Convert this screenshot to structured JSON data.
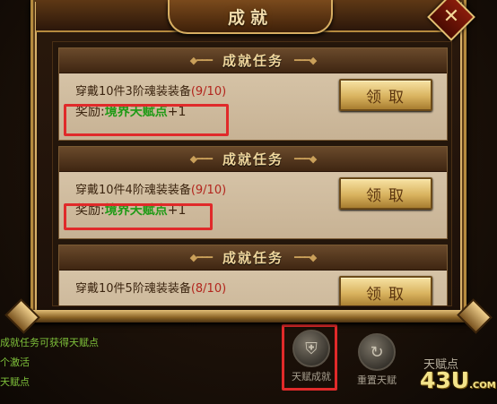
{
  "dialog": {
    "title": "成就",
    "close_icon": "✕"
  },
  "cards": [
    {
      "header": "成就任务",
      "task": "穿戴10件3阶魂装装备",
      "progress": "(9/10)",
      "reward_label": "奖励:",
      "reward_name": "境界天赋点",
      "reward_value": "+1",
      "button": "领取"
    },
    {
      "header": "成就任务",
      "task": "穿戴10件4阶魂装装备",
      "progress": "(9/10)",
      "reward_label": "奖励:",
      "reward_name": "境界天赋点",
      "reward_value": "+1",
      "button": "领取"
    },
    {
      "header": "成就任务",
      "task": "穿戴10件5阶魂装装备",
      "progress": "(8/10)",
      "button": "领取"
    }
  ],
  "tips": [
    "成就任务可获得天赋点",
    "个激活",
    "天赋点"
  ],
  "bottom_buttons": [
    {
      "icon": "shield-emblem-icon",
      "label": "天赋成就"
    },
    {
      "icon": "reset-swirl-icon",
      "label": "重置天赋"
    }
  ],
  "talent_points_label": "天赋点",
  "watermark": {
    "main": "43U",
    "suffix": ".COM"
  },
  "colors": {
    "gold": "#d7ae62",
    "highlight": "#e02a2a",
    "reward_green": "#1f9a16",
    "progress_red": "#b2251d"
  }
}
